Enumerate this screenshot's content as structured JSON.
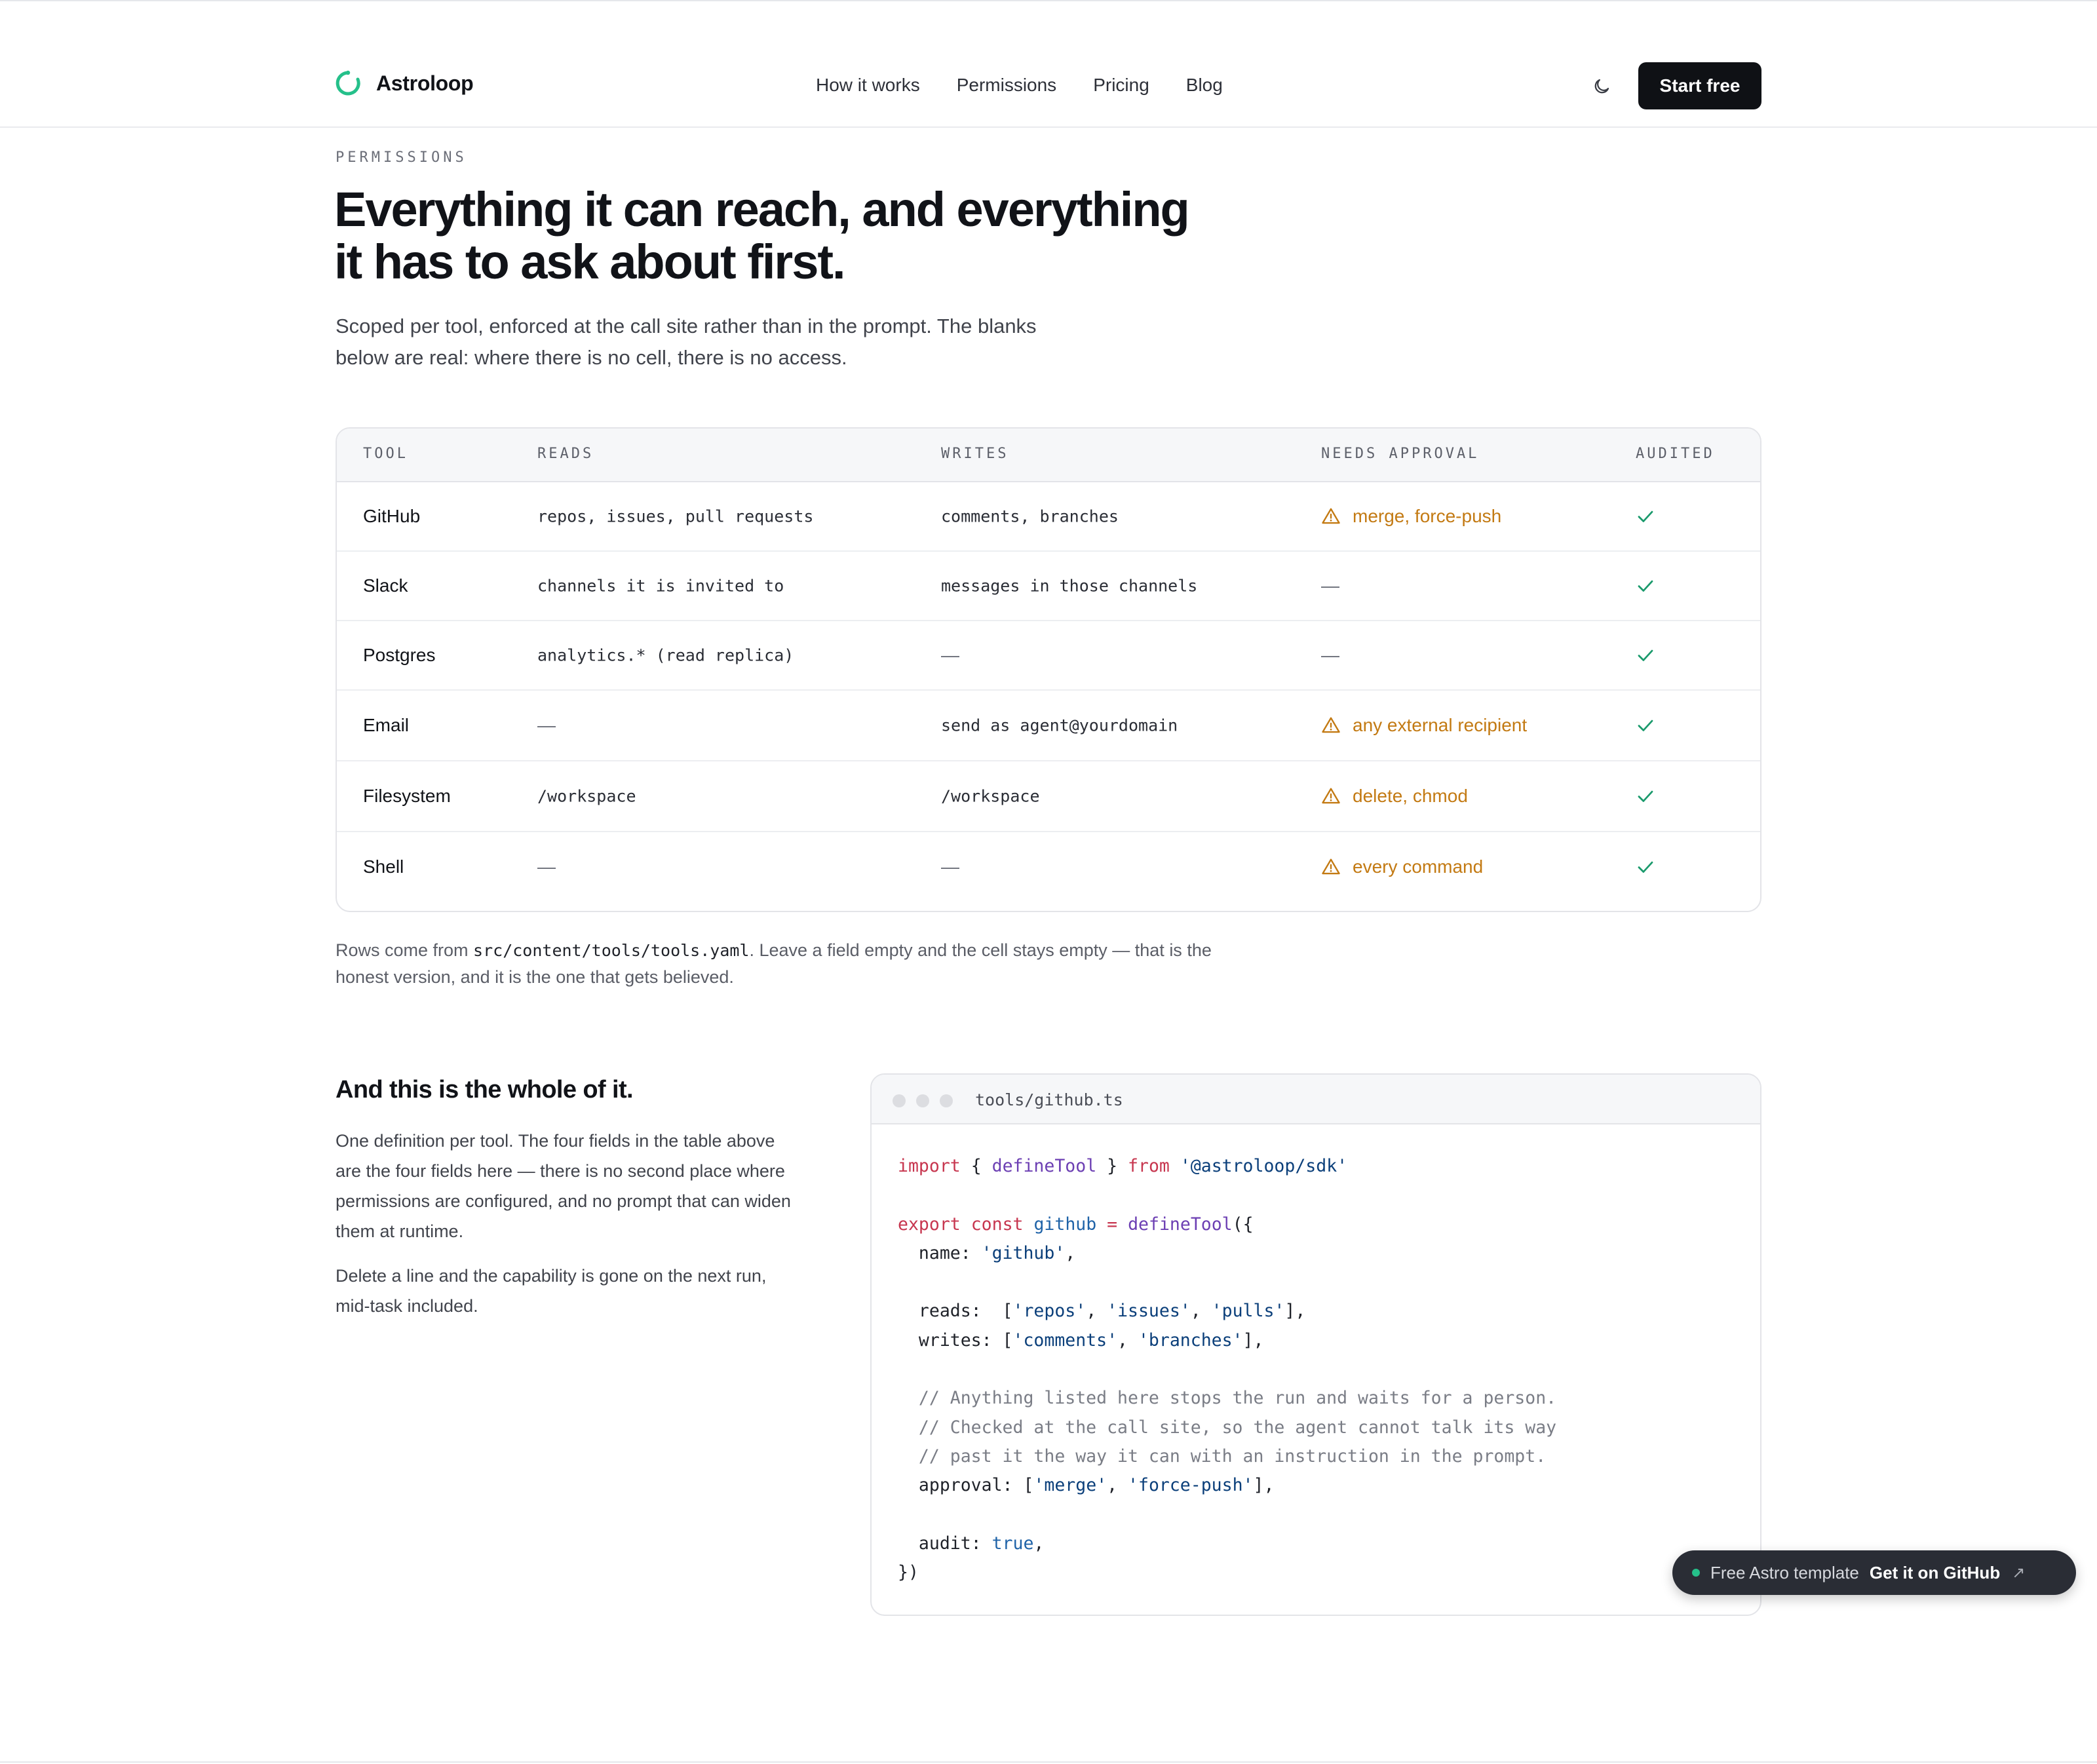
{
  "header": {
    "brand": "Astroloop",
    "nav": [
      "How it works",
      "Permissions",
      "Pricing",
      "Blog"
    ],
    "cta": "Start free"
  },
  "intro": {
    "eyebrow": "PERMISSIONS",
    "headline_line1": "Everything it can reach, and everything",
    "headline_line2": "it has to ask about first.",
    "lede": "Scoped per tool, enforced at the call site rather than in the prompt. The blanks below are real: where there is no cell, there is no access."
  },
  "table": {
    "columns": [
      "TOOL",
      "READS",
      "WRITES",
      "NEEDS APPROVAL",
      "AUDITED"
    ],
    "rows": [
      {
        "tool": "GitHub",
        "reads": "repos, issues, pull requests",
        "writes": "comments, branches",
        "approval": "merge, force-push",
        "audited": "✓"
      },
      {
        "tool": "Slack",
        "reads": "channels it is invited to",
        "writes": "messages in those channels",
        "approval": "—",
        "audited": "✓"
      },
      {
        "tool": "Postgres",
        "reads": "analytics.* (read replica)",
        "writes": "—",
        "approval": "—",
        "audited": "✓"
      },
      {
        "tool": "Email",
        "reads": "—",
        "writes": "send as agent@yourdomain",
        "approval": "any external recipient",
        "audited": "✓"
      },
      {
        "tool": "Filesystem",
        "reads": "/workspace",
        "writes": "/workspace",
        "approval": "delete, chmod",
        "audited": "✓"
      },
      {
        "tool": "Shell",
        "reads": "—",
        "writes": "—",
        "approval": "every command",
        "audited": "✓"
      }
    ],
    "note_prefix": "Rows come from ",
    "note_path": "src/content/tools/tools.yaml",
    "note_suffix": ". Leave a field empty and the cell stays empty — that is the honest version, and it is the one that gets believed."
  },
  "section": {
    "title": "And this is the whole of it.",
    "p1": "One definition per tool. The four fields in the table above are the four fields here — there is no second place where permissions are configured, and no prompt that can widen them at runtime.",
    "p2": "Delete a line and the capability is gone on the next run, mid-task included."
  },
  "code": {
    "filename": "tools/github.ts",
    "lines": [
      "import { defineTool } from '@astroloop/sdk'",
      "",
      "export const github = defineTool({",
      "  name: 'github',",
      "",
      "  reads:  ['repos', 'issues', 'pulls'],",
      "  writes: ['comments', 'branches'],",
      "",
      "  // Anything listed here stops the run and waits for a person.",
      "  // Checked at the call site, so the agent cannot talk its way",
      "  // past it the way it can with an instruction in the prompt.",
      "  approval: ['merge', 'force-push'],",
      "",
      "  audit: true,",
      "})"
    ]
  },
  "pill": {
    "label": "Free Astro template",
    "cta": "Get it on GitHub",
    "arrow": "↗"
  },
  "colors": {
    "accent_green": "#25c08a",
    "approval_amber": "#c37a13",
    "check_green": "#1a9a6c",
    "cta_bg": "#0f1115"
  }
}
